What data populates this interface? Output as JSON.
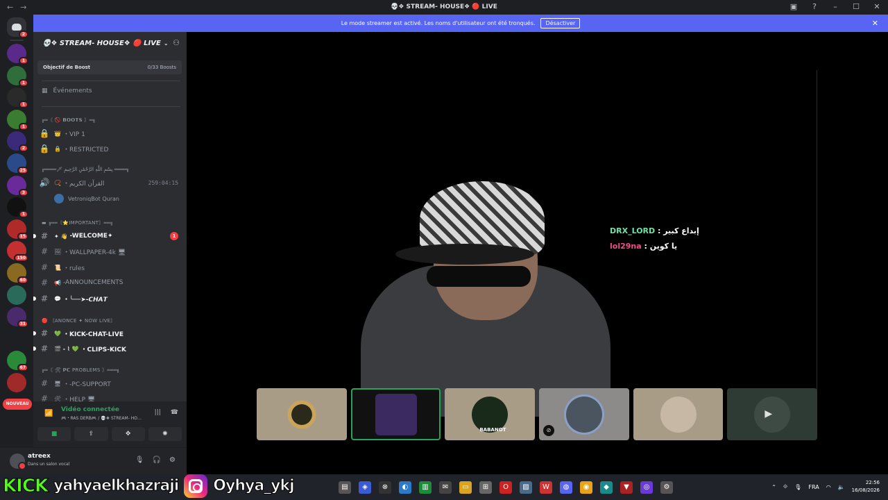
{
  "window": {
    "title": "💀❖ STREAM- HOUSE❖ 🔴 LIVE"
  },
  "banner": {
    "text": "Le mode streamer est activé. Les noms d'utilisateur ont été tronqués.",
    "button_label": "Désactiver"
  },
  "server_rail": {
    "servers": [
      {
        "badge": "1",
        "color": "#5a2a8a"
      },
      {
        "badge": "1",
        "color": "#2f6e3a"
      },
      {
        "badge": "1",
        "color": "#2a2a2a"
      },
      {
        "badge": "1",
        "color": "#3a7d30"
      },
      {
        "badge": "2",
        "color": "#3b2a7a"
      },
      {
        "badge": "25",
        "color": "#2b4a8a"
      },
      {
        "badge": "3",
        "color": "#6a2a9a"
      },
      {
        "badge": "1",
        "color": "#111111"
      },
      {
        "badge": "15",
        "color": "#b02a2a"
      },
      {
        "badge": "150",
        "color": "#c43030"
      },
      {
        "badge": "60",
        "color": "#8a6a20"
      },
      {
        "badge": "",
        "color": "#2a6a5a"
      },
      {
        "badge": "31",
        "color": "#4a2a6a"
      },
      {
        "badge": "",
        "color": "#1e1f22"
      },
      {
        "badge": "67",
        "color": "#2a8a3a"
      },
      {
        "badge": "",
        "color": "#a02a2a"
      }
    ],
    "new_label": "NOUVEAU"
  },
  "sidebar": {
    "guild_name": "💀❖ STREAM- HOUSE❖ 🔴 LIVE",
    "boost_label": "Objectif de Boost",
    "boost_count": "0/33 Boosts",
    "events_label": "Événements",
    "categories": {
      "c1": "╔═〘 🚫 𝗕𝗢𝗢𝗧𝗦 〙═╗",
      "c2": "╔════🗡 بِسْمِ اللَّهِ الرَّحْمَٰنِ الرَّحِيمِ ════╗",
      "c3": "▬ ╔══〘⭐IMPORTANT〙══╗",
      "c4": "🔴 〘ANONCE ✦ NOW LIVE〙",
      "c5": "╔═〘 🛠 𝗣𝗖 PROBLEMS 〙═══╗"
    },
    "channels": {
      "vip": {
        "emoji": "👑",
        "label": "・VIP 1"
      },
      "restricted": {
        "emoji": "🔒",
        "label": "・RESTRICTED"
      },
      "quran": {
        "emoji": "📿",
        "label": "・القرآن الكريم",
        "timer": "259:04:15"
      },
      "quran_user": "VetroniqBot Quran",
      "welcome": {
        "emoji": "✦ 👋",
        "label": "-WELCOME✦",
        "mentions": "1"
      },
      "wallpaper": {
        "emoji": "🖼",
        "label": "・WALLPAPER-4k 🖥"
      },
      "rules": {
        "emoji": "📜",
        "label": "・rules"
      },
      "announcements": {
        "emoji": "📢",
        "label": "-ANNOUNCEMENTS"
      },
      "chat": {
        "emoji": "💬",
        "label": "・╰──➤-𝘾𝙃𝘼𝙏"
      },
      "kick_chat": {
        "emoji": "💚",
        "label": "・KICK-CHAT-LIVE"
      },
      "clips_kick": {
        "emoji": "🎬 ‐ ⌇ 💚",
        "label": "・CLIPS-KICK"
      },
      "pc_support": {
        "emoji": "🖥",
        "label": "・-PC-SUPPORT"
      },
      "help": {
        "emoji": "🛠",
        "label": "・HELP 🖥"
      }
    }
  },
  "voice_panel": {
    "status": "Vidéo connectée",
    "channel": "🎮・RAS DERB🎮 / 💀❖ STREAM- HO…"
  },
  "user_panel": {
    "name": "atreex",
    "status": "Dans un salon vocal"
  },
  "stage": {
    "chat": [
      {
        "user": "DRX_LORD",
        "message": " : إبداع كبير"
      },
      {
        "user": "lol29na",
        "message": " : يا كوين"
      }
    ],
    "tiles": [
      {
        "kind": "avatar"
      },
      {
        "kind": "speaking"
      },
      {
        "kind": "avatar",
        "name": "BABANOT"
      },
      {
        "kind": "avatar-muted"
      },
      {
        "kind": "avatar"
      },
      {
        "kind": "camera-off"
      }
    ]
  },
  "overlay": {
    "kick_logo": "KICK",
    "kick_handle": "yahyaelkhazraji",
    "ig_handle": "Oyhya_ykj"
  },
  "taskbar": {
    "lang": "FRA",
    "time": "22:56",
    "date": "16/08/2026"
  }
}
